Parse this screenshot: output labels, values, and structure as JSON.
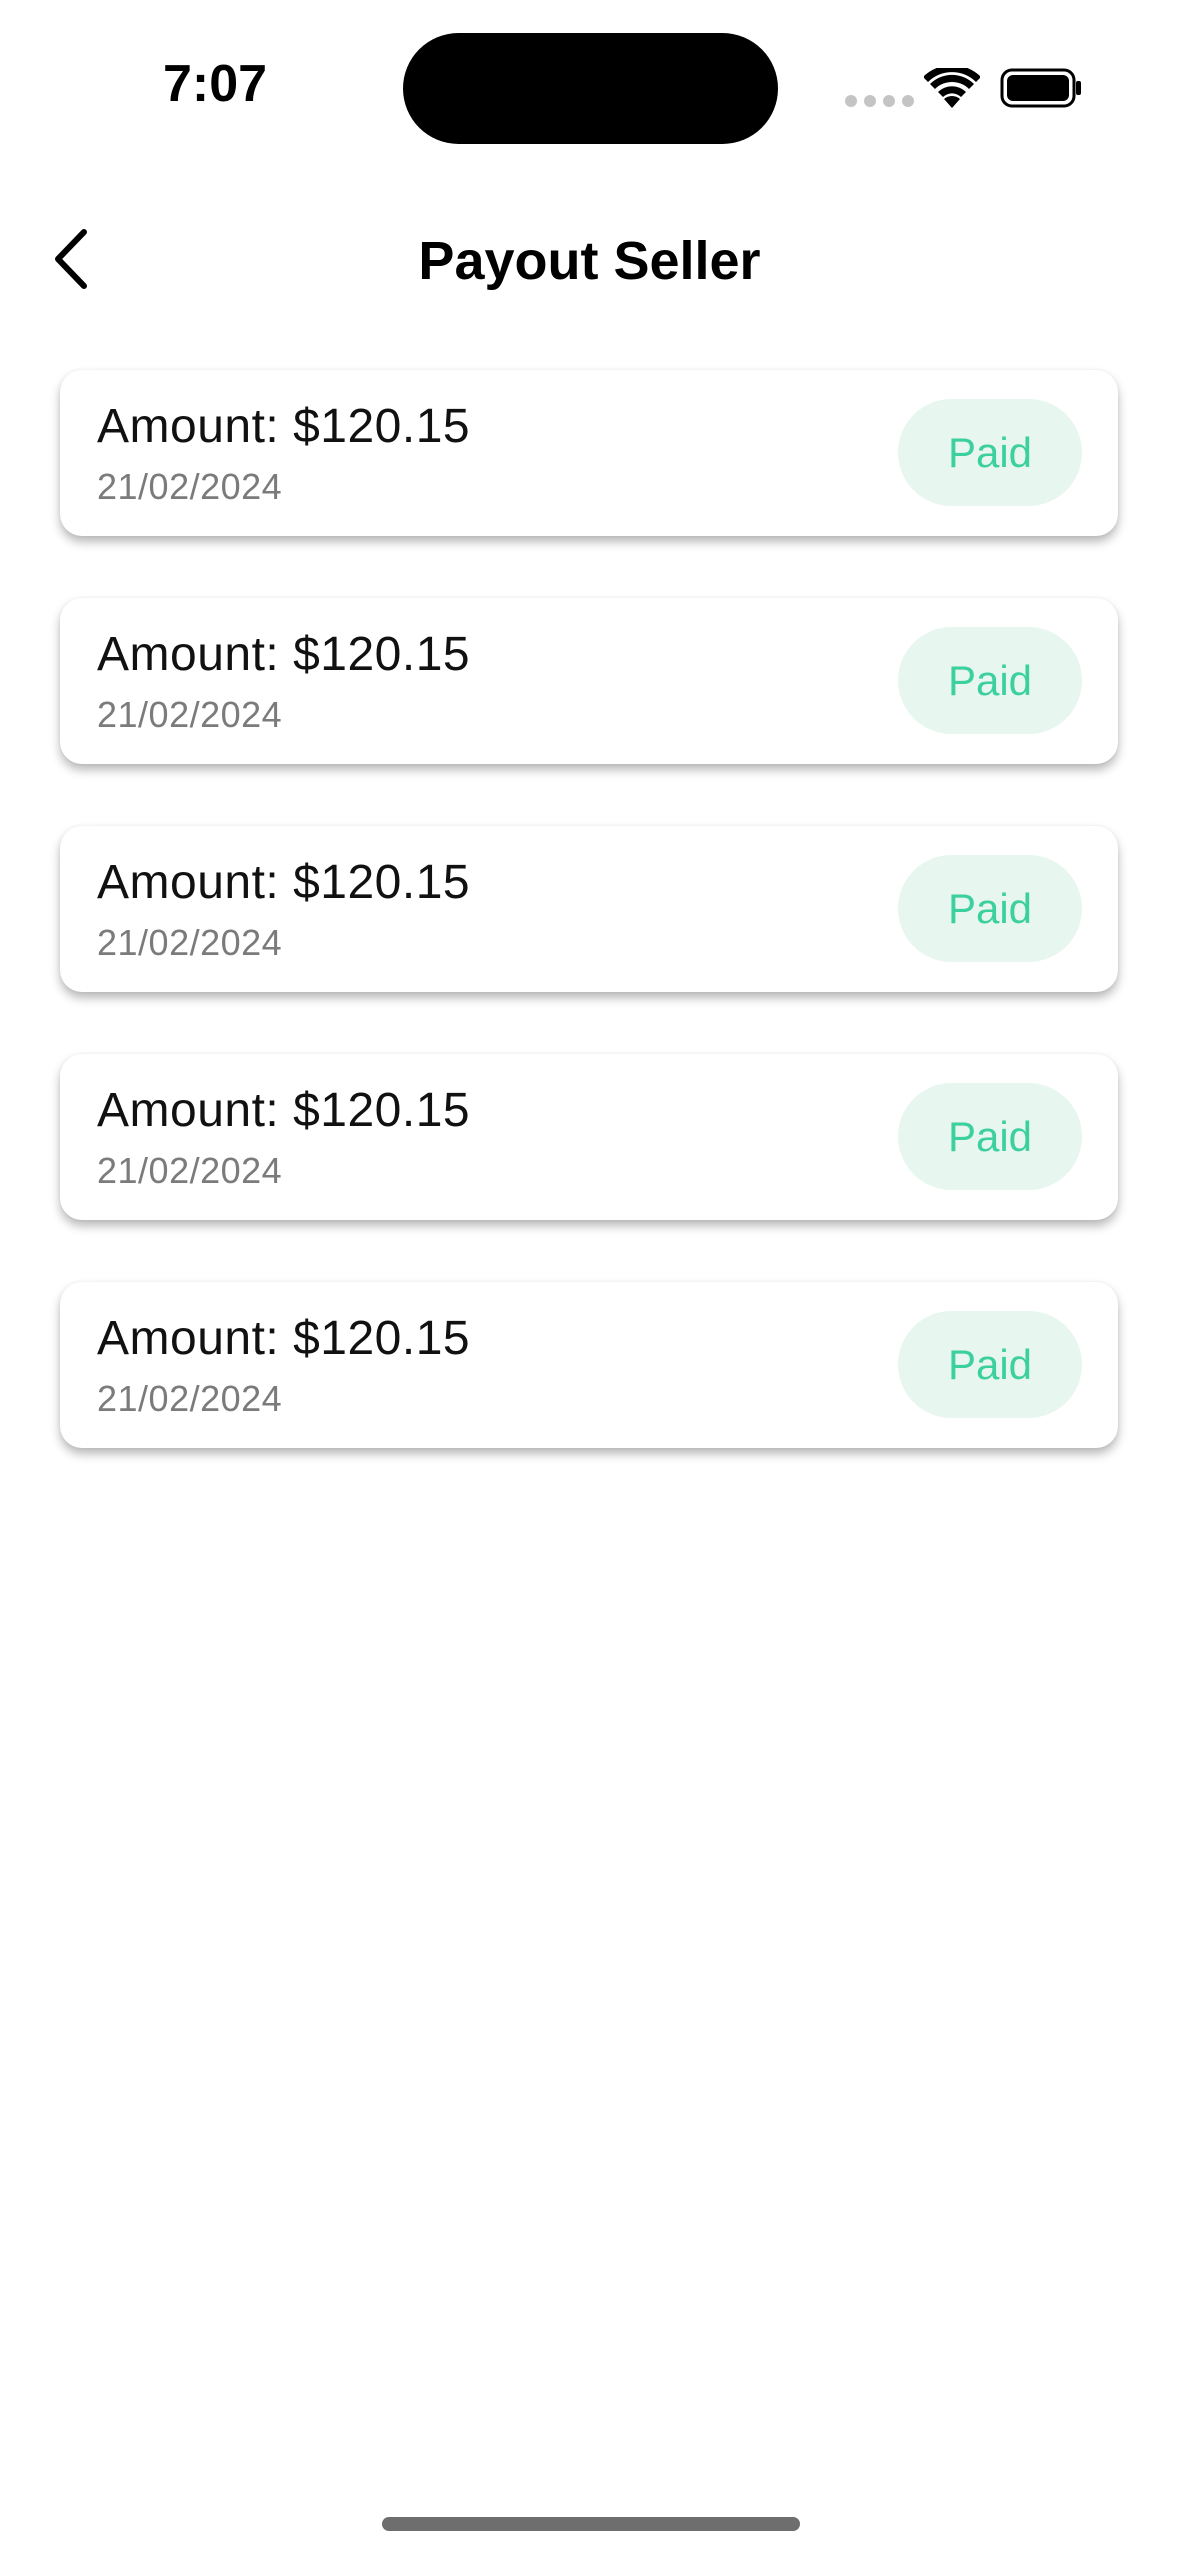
{
  "status_bar": {
    "time": "7:07"
  },
  "header": {
    "title": "Payout Seller",
    "back_icon": "chevron-left-icon"
  },
  "payouts": [
    {
      "amount": "Amount: $120.15",
      "date": "21/02/2024",
      "status": "Paid"
    },
    {
      "amount": "Amount: $120.15",
      "date": "21/02/2024",
      "status": "Paid"
    },
    {
      "amount": "Amount: $120.15",
      "date": "21/02/2024",
      "status": "Paid"
    },
    {
      "amount": "Amount: $120.15",
      "date": "21/02/2024",
      "status": "Paid"
    },
    {
      "amount": "Amount: $120.15",
      "date": "21/02/2024",
      "status": "Paid"
    }
  ],
  "colors": {
    "paid_text": "#3ccf9f",
    "paid_background": "#e7f6ee",
    "date_text": "#7b7b7b"
  }
}
